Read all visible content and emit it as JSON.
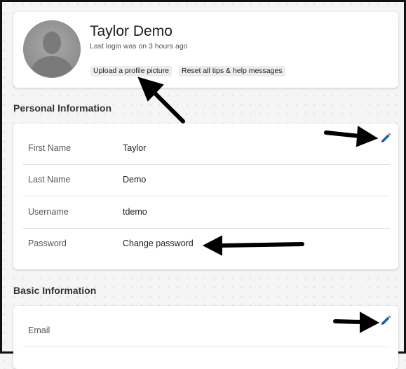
{
  "profile": {
    "name": "Taylor Demo",
    "last_login": "Last login was on 3 hours ago",
    "upload_label": "Upload a profile picture",
    "reset_label": "Reset all tips & help messages"
  },
  "personal": {
    "title": "Personal Information",
    "rows": [
      {
        "label": "First Name",
        "value": "Taylor"
      },
      {
        "label": "Last Name",
        "value": "Demo"
      },
      {
        "label": "Username",
        "value": "tdemo"
      },
      {
        "label": "Password",
        "value": "Change password"
      }
    ]
  },
  "basic": {
    "title": "Basic Information",
    "rows": [
      {
        "label": "Email",
        "value": ""
      }
    ]
  },
  "icons": {
    "edit": "pencil-icon",
    "avatar": "user-silhouette-icon",
    "annotation": "arrow-icon"
  },
  "colors": {
    "edit_icon": "#1a5fb4",
    "annotation_arrow": "#000000"
  }
}
